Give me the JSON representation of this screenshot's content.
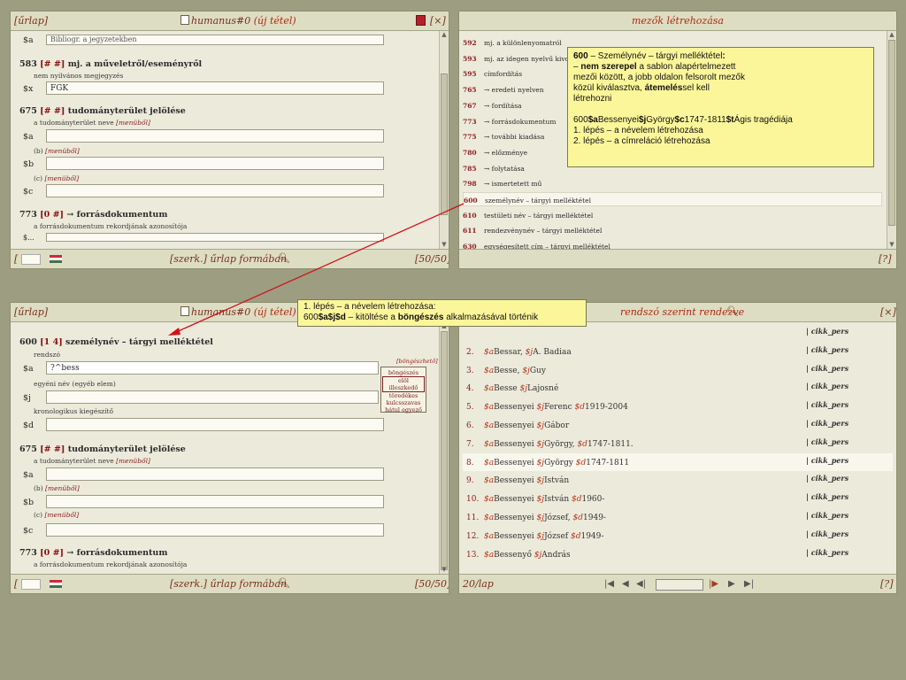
{
  "p1": {
    "header": {
      "left": "[űrlap]",
      "title": "humanus#0",
      "title_suffix": "(új tétel)",
      "close": "[×]"
    },
    "top_field_value": "Bibliogr. a jegyzetekben",
    "f583": {
      "tag": "583",
      "ind": "[# #]",
      "name": "mj. a műveletről/eseményről",
      "desc": "nem nyilvános megjegyzés",
      "code": "$x",
      "value": "FGK"
    },
    "f675": {
      "tag": "675",
      "ind": "[# #]",
      "name": "tudományterület jelölése",
      "desc": "a tudományterület neve",
      "menu": "[menüből]",
      "a": "$a",
      "b_hint": "(b)",
      "b": "$b",
      "c_hint": "(c)",
      "c": "$c"
    },
    "f773": {
      "tag": "773",
      "ind1": "[0",
      "ind2": "#]",
      "name": "→ forrásdokumentum",
      "desc": "a forrásdokumentum rekordjának azonosítója",
      "cut": "$..."
    },
    "footer": {
      "left": "[",
      "mode": "[szerk.] űrlap formában",
      "count": "[50/50]"
    }
  },
  "p2": {
    "header": {
      "title": "mezők létrehozása"
    },
    "rows": [
      {
        "n": "592",
        "t": "mj. a különlenyomatról"
      },
      {
        "n": "593",
        "t": "mj. az idegen nyelvű kivonat"
      },
      {
        "n": "595",
        "t": "címfordítás"
      },
      {
        "n": "765",
        "t": "→ eredeti nyelven"
      },
      {
        "n": "767",
        "t": "→ fordítása"
      },
      {
        "n": "773",
        "t": "→ forrásdokumentum"
      },
      {
        "n": "775",
        "t": "→ további kiadása"
      },
      {
        "n": "780",
        "t": "→ előzménye"
      },
      {
        "n": "785",
        "t": "→ folytatása"
      },
      {
        "n": "798",
        "t": "→ ismertetett mű"
      },
      {
        "n": "600",
        "t": "személynév – tárgyi melléktétel"
      },
      {
        "n": "610",
        "t": "testületi név – tárgyi melléktétel"
      },
      {
        "n": "611",
        "t": "rendezvénynév – tárgyi melléktétel"
      },
      {
        "n": "630",
        "t": "egységesített cím – tárgyi melléktétel"
      }
    ],
    "callout": {
      "l1a": "600",
      "l1b": " – Személynév – tárgyi melléktétel",
      "l2a": "– ",
      "l2b": "nem szerepel",
      "l2c": " a sablon alapértelmezett",
      "l3": "mezői között, a jobb oldalon felsorolt mezők",
      "l4a": "közül kiválasztva, ",
      "l4b": "átemelés",
      "l4c": "sel kell",
      "l5": "létrehozni",
      "l6": "600$aBessenyei$jGyörgy$c1747-1811$tÁgis tragédiája",
      "l7": "1. lépés – a névelem létrehozása",
      "l8": "2. lépés – a címreláció létrehozása"
    },
    "footer": {
      "help": "[?]"
    }
  },
  "p3": {
    "header": {
      "left": "[űrlap]",
      "title": "humanus#0",
      "title_suffix": "(új tétel)"
    },
    "f600": {
      "tag": "600",
      "ind1": "[1",
      "ind2": "4]",
      "name": "személynév – tárgyi melléktétel",
      "desc": "rendszó",
      "a": "$a",
      "a_value": "?^bess",
      "desc2": "egyéni név (egyéb elem)",
      "j": "$j",
      "desc3": "kronologikus kiegészítő",
      "d": "$d"
    },
    "popup": {
      "title": "[böngészhető]",
      "items": [
        "böngészés",
        "elöl illeszkedő",
        "töredékes",
        "kulcsszavas",
        "hátul egyező"
      ]
    },
    "f675": {
      "tag": "675",
      "ind": "[# #]",
      "name": "tudományterület jelölése",
      "desc": "a tudományterület neve",
      "menu": "[menüből]",
      "a": "$a",
      "b_hint": "(b)",
      "b": "$b",
      "c_hint": "(c)",
      "c": "$c"
    },
    "f773": {
      "tag": "773",
      "ind1": "[0",
      "ind2": "#]",
      "name": "→ forrásdokumentum",
      "desc": "a forrásdokumentum rekordjának azonosítója"
    },
    "footer": {
      "left": "[",
      "mode": "[szerk.] űrlap formában",
      "count": "[50/50]"
    }
  },
  "p4": {
    "header": {
      "title": "rendszó szerint rendezve",
      "close": "[×]"
    },
    "rows": [
      {
        "n": "",
        "t": "",
        "c": "| cikk_pers"
      },
      {
        "n": "2.",
        "pre": "$a",
        "t": "Bessar, ",
        "s1": "$j",
        "t2": "A. Badiaa",
        "c": "| cikk_pers"
      },
      {
        "n": "3.",
        "pre": "$a",
        "t": "Besse, ",
        "s1": "$j",
        "t2": "Guy",
        "c": "| cikk_pers"
      },
      {
        "n": "4.",
        "pre": "$a",
        "t": "Besse ",
        "s1": "$j",
        "t2": "Lajosné",
        "c": "| cikk_pers"
      },
      {
        "n": "5.",
        "pre": "$a",
        "t": "Bessenyei ",
        "s1": "$j",
        "t2": "Ferenc ",
        "s2": "$d",
        "t3": "1919-2004",
        "c": "| cikk_pers"
      },
      {
        "n": "6.",
        "pre": "$a",
        "t": "Bessenyei ",
        "s1": "$j",
        "t2": "Gábor",
        "c": "| cikk_pers"
      },
      {
        "n": "7.",
        "pre": "$a",
        "t": "Bessenyei ",
        "s1": "$j",
        "t2": "György, ",
        "s2": "$d",
        "t3": "1747-1811.",
        "c": "| cikk_pers"
      },
      {
        "n": "8.",
        "pre": "$a",
        "t": "Bessenyei ",
        "s1": "$j",
        "t2": "György ",
        "s2": "$d",
        "t3": "1747-1811",
        "c": "| cikk_pers"
      },
      {
        "n": "9.",
        "pre": "$a",
        "t": "Bessenyei ",
        "s1": "$j",
        "t2": "István",
        "c": "| cikk_pers"
      },
      {
        "n": "10.",
        "pre": "$a",
        "t": "Bessenyei ",
        "s1": "$j",
        "t2": "István ",
        "s2": "$d",
        "t3": "1960-",
        "c": "| cikk_pers"
      },
      {
        "n": "11.",
        "pre": "$a",
        "t": "Bessenyei ",
        "s1": "$j",
        "t2": "József, ",
        "s2": "$d",
        "t3": "1949-",
        "c": "| cikk_pers"
      },
      {
        "n": "12.",
        "pre": "$a",
        "t": "Bessenyei ",
        "s1": "$j",
        "t2": "József ",
        "s2": "$d",
        "t3": "1949-",
        "c": "| cikk_pers"
      },
      {
        "n": "13.",
        "pre": "$a",
        "t": "Bessenyő ",
        "s1": "$j",
        "t2": "András",
        "c": "| cikk_pers"
      }
    ],
    "footer": {
      "per_page": "20/lap",
      "help": "[?]"
    }
  },
  "callout2": {
    "l1": "1. lépés – a névelem létrehozása:",
    "l2a": "600",
    "l2b": "$a$j$d",
    "l2c": " – kitöltése a ",
    "l2d": "böngészés",
    "l2e": " alkalmazásával történik"
  },
  "colors": {
    "background": "#9c9d81",
    "panel": "#eceadb",
    "callout": "#fcf69a",
    "arrow": "#d0121a",
    "link": "#7a2e1c"
  }
}
